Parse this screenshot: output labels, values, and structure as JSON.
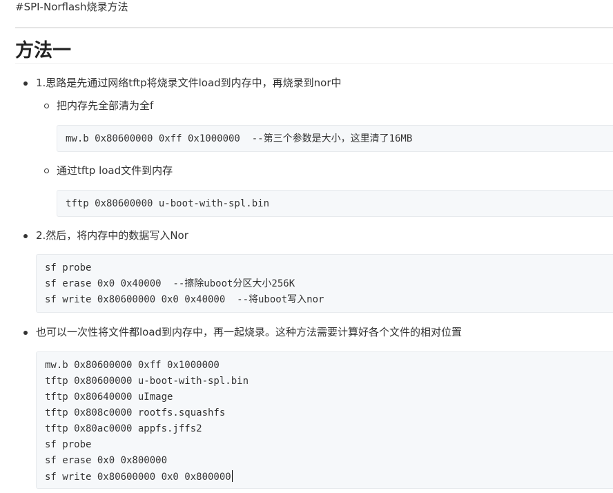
{
  "header": {
    "tag_text": "#SPI-Norflash烧录方法",
    "h1": "方法一"
  },
  "items": {
    "item1": "1.思路是先通过网络tftp将烧录文件load到内存中，再烧录到nor中",
    "sub1": "把内存先全部清为全f",
    "code1": [
      "mw.b 0x80600000 0xff 0x1000000  --第三个参数是大小，这里清了16MB"
    ],
    "sub2": "通过tftp load文件到内存",
    "code2": [
      "tftp 0x80600000 u-boot-with-spl.bin"
    ],
    "item2": "2.然后，将内存中的数据写入Nor",
    "code3": [
      "sf probe",
      "sf erase 0x0 0x40000  --擦除uboot分区大小256K",
      "sf write 0x80600000 0x0 0x40000  --将uboot写入nor"
    ],
    "item3": "也可以一次性将文件都load到内存中，再一起烧录。这种方法需要计算好各个文件的相对位置",
    "code4": [
      "mw.b 0x80600000 0xff 0x1000000",
      "tftp 0x80600000 u-boot-with-spl.bin",
      "tftp 0x80640000 uImage",
      "tftp 0x808c0000 rootfs.squashfs",
      "tftp 0x80ac0000 appfs.jffs2",
      "sf probe",
      "sf erase 0x0 0x800000",
      "sf write 0x80600000 0x0 0x800000"
    ]
  }
}
